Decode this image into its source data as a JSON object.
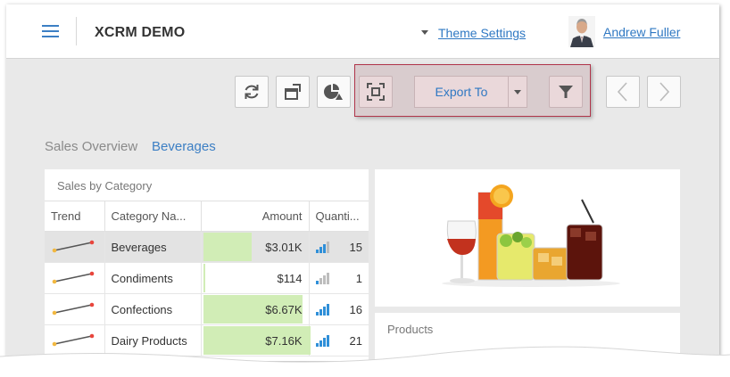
{
  "header": {
    "app_title": "XCRM DEMO",
    "theme_link": "Theme Settings",
    "user_name": "Andrew Fuller"
  },
  "toolbar": {
    "refresh_icon": "refresh-icon",
    "restore_icon": "restore-window-icon",
    "chart_icon": "pie-chart-icon",
    "fullscreen_icon": "fullscreen-icon",
    "export_label": "Export To",
    "filter_icon": "filter-icon",
    "prev_icon": "chevron-left-icon",
    "next_icon": "chevron-right-icon",
    "highlight_color": "#b0354a"
  },
  "breadcrumb": {
    "root": "Sales Overview",
    "current": "Beverages"
  },
  "sales_grid": {
    "title": "Sales by Category",
    "columns": [
      "Trend",
      "Category Na...",
      "Amount",
      "Quanti..."
    ],
    "rows": [
      {
        "category": "Beverages",
        "amount": "$3.01K",
        "amount_fraction": 0.45,
        "quantity": "15",
        "qty_level": 3,
        "selected": true
      },
      {
        "category": "Condiments",
        "amount": "$114",
        "amount_fraction": 0.02,
        "quantity": "1",
        "qty_level": 1,
        "selected": false
      },
      {
        "category": "Confections",
        "amount": "$6.67K",
        "amount_fraction": 0.93,
        "quantity": "16",
        "qty_level": 4,
        "selected": false
      },
      {
        "category": "Dairy Products",
        "amount": "$7.16K",
        "amount_fraction": 1.0,
        "quantity": "21",
        "qty_level": 4,
        "selected": false
      }
    ],
    "bar_color": "#d1edb6",
    "qty_color": "#2f8fd8"
  },
  "products": {
    "title": "Products"
  }
}
